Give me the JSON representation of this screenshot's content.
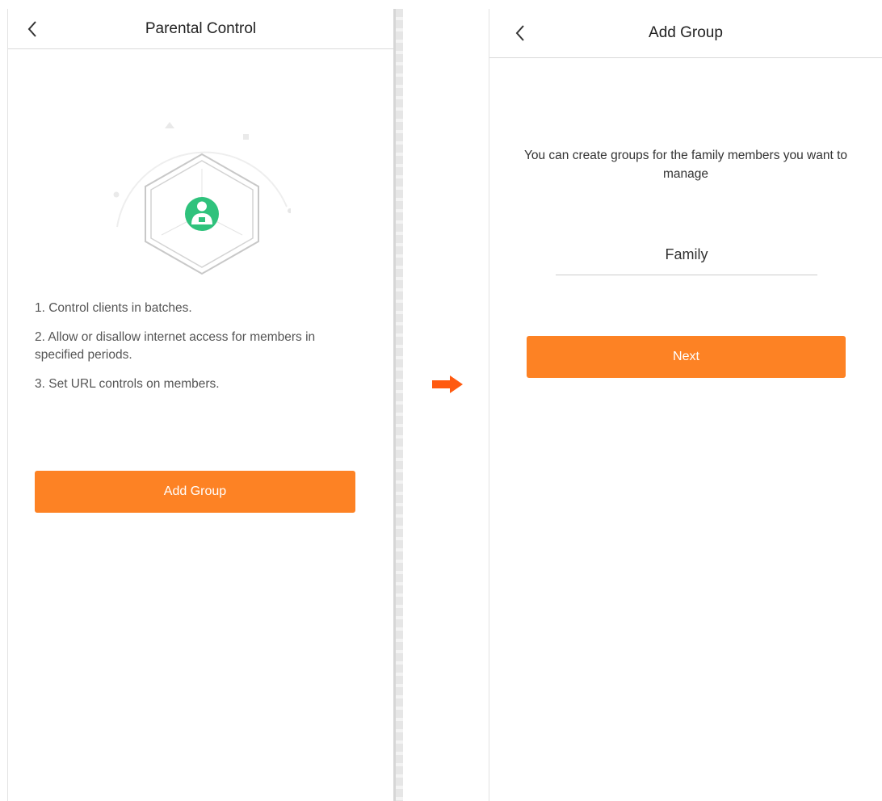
{
  "screens": {
    "parental_control": {
      "title": "Parental Control",
      "features": [
        "1. Control clients in batches.",
        "2. Allow or disallow internet access for members in specified periods.",
        "3. Set URL controls on members."
      ],
      "add_group_label": "Add Group"
    },
    "add_group": {
      "title": "Add Group",
      "hint": "You can create groups for the family members you want to manage",
      "group_name_value": "Family",
      "next_label": "Next"
    }
  },
  "icons": {
    "back": "chevron-left-icon",
    "user_badge": "user-badge-icon",
    "flow_arrow": "arrow-right-icon"
  },
  "colors": {
    "primary": "#fd8224",
    "arrow": "#ff5a10",
    "user_badge": "#2fc27c"
  }
}
